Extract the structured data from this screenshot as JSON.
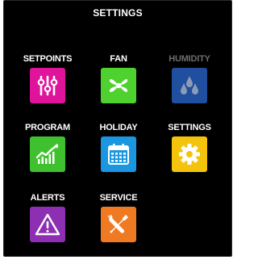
{
  "header": {
    "title": "SETTINGS"
  },
  "menu": {
    "items": [
      {
        "label": "SETPOINTS",
        "icon": "sliders-icon",
        "color": "#e0149a",
        "enabled": true
      },
      {
        "label": "FAN",
        "icon": "fan-icon",
        "color": "#4fd22f",
        "enabled": true
      },
      {
        "label": "HUMIDITY",
        "icon": "water-drops-icon",
        "color": "#1f4f9e",
        "enabled": false
      },
      {
        "label": "PROGRAM",
        "icon": "line-chart-icon",
        "color": "#3fc02e",
        "enabled": true
      },
      {
        "label": "HOLIDAY",
        "icon": "calendar-icon",
        "color": "#1b96e0",
        "enabled": true
      },
      {
        "label": "SETTINGS",
        "icon": "gear-icon",
        "color": "#f4c40c",
        "enabled": true
      },
      {
        "label": "ALERTS",
        "icon": "warning-icon",
        "color": "#8c2fb2",
        "enabled": true
      },
      {
        "label": "SERVICE",
        "icon": "tools-icon",
        "color": "#ef7a22",
        "enabled": true
      }
    ]
  }
}
